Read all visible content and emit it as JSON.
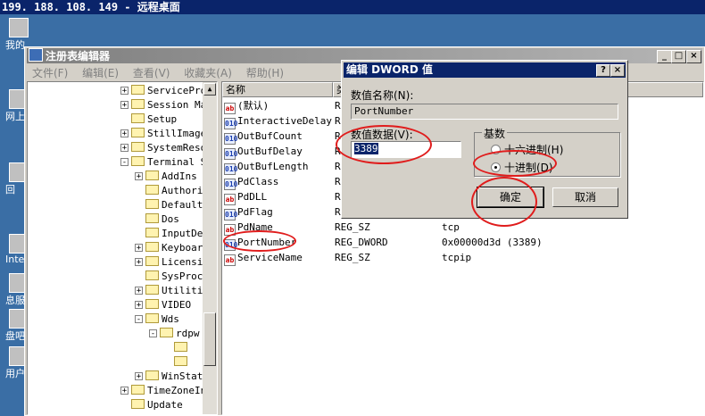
{
  "rdp": {
    "title": "199. 188. 108. 149 - 远程桌面"
  },
  "desktop": {
    "icons": [
      {
        "name": "my-computer-icon",
        "label": "我的"
      },
      {
        "name": "network-icon",
        "label": "网上"
      },
      {
        "name": "recycle-icon",
        "label": "回"
      },
      {
        "name": "internet-icon",
        "label": "Inter"
      },
      {
        "name": "service-icon",
        "label": "息服务"
      },
      {
        "name": "disk-icon",
        "label": "盘吧"
      },
      {
        "name": "tool-icon",
        "label": "用户"
      }
    ]
  },
  "regedit": {
    "title": "注册表编辑器",
    "menu": [
      "文件(F)",
      "编辑(E)",
      "查看(V)",
      "收藏夹(A)",
      "帮助(H)"
    ],
    "tree": [
      {
        "label": "ServicePro",
        "depth": 0,
        "expander": "+"
      },
      {
        "label": "Session Ma",
        "depth": 0,
        "expander": "+"
      },
      {
        "label": "Setup",
        "depth": 0,
        "expander": ""
      },
      {
        "label": "StillImage",
        "depth": 0,
        "expander": "+"
      },
      {
        "label": "SystemReso",
        "depth": 0,
        "expander": "+"
      },
      {
        "label": "Terminal S",
        "depth": 0,
        "expander": "-"
      },
      {
        "label": "AddIns",
        "depth": 1,
        "expander": "+"
      },
      {
        "label": "Authori",
        "depth": 1,
        "expander": ""
      },
      {
        "label": "Default",
        "depth": 1,
        "expander": ""
      },
      {
        "label": "Dos",
        "depth": 1,
        "expander": ""
      },
      {
        "label": "InputDe",
        "depth": 1,
        "expander": ""
      },
      {
        "label": "Keyboar",
        "depth": 1,
        "expander": "+"
      },
      {
        "label": "Licensi",
        "depth": 1,
        "expander": "+"
      },
      {
        "label": "SysProc",
        "depth": 1,
        "expander": ""
      },
      {
        "label": "Utiliti",
        "depth": 1,
        "expander": "+"
      },
      {
        "label": "VIDEO",
        "depth": 1,
        "expander": "+"
      },
      {
        "label": "Wds",
        "depth": 1,
        "expander": "-"
      },
      {
        "label": "rdpw",
        "depth": 2,
        "expander": "-"
      },
      {
        "label": "",
        "depth": 3,
        "expander": ""
      },
      {
        "label": "",
        "depth": 3,
        "expander": ""
      },
      {
        "label": "WinStat",
        "depth": 1,
        "expander": "+"
      },
      {
        "label": "TimeZoneIn",
        "depth": 0,
        "expander": "+"
      },
      {
        "label": "Update",
        "depth": 0,
        "expander": ""
      }
    ],
    "columns": {
      "name": "名称",
      "type": "类",
      "data": ""
    },
    "values": [
      {
        "icon": "ab",
        "kind": "sz",
        "name": "(默认)",
        "type": "R",
        "data": ""
      },
      {
        "icon": "010",
        "kind": "bin",
        "name": "InteractiveDelay",
        "type": "R",
        "data": ""
      },
      {
        "icon": "010",
        "kind": "bin",
        "name": "OutBufCount",
        "type": "R",
        "data": ""
      },
      {
        "icon": "010",
        "kind": "bin",
        "name": "OutBufDelay",
        "type": "R",
        "data": ""
      },
      {
        "icon": "010",
        "kind": "bin",
        "name": "OutBufLength",
        "type": "R",
        "data": ""
      },
      {
        "icon": "010",
        "kind": "bin",
        "name": "PdClass",
        "type": "R",
        "data": ""
      },
      {
        "icon": "ab",
        "kind": "sz",
        "name": "PdDLL",
        "type": "R",
        "data": ""
      },
      {
        "icon": "010",
        "kind": "bin",
        "name": "PdFlag",
        "type": "R",
        "data": ""
      },
      {
        "icon": "ab",
        "kind": "sz",
        "name": "PdName",
        "type": "REG_SZ",
        "data": "tcp"
      },
      {
        "icon": "010",
        "kind": "bin",
        "name": "PortNumber",
        "type": "REG_DWORD",
        "data": "0x00000d3d (3389)"
      },
      {
        "icon": "ab",
        "kind": "sz",
        "name": "ServiceName",
        "type": "REG_SZ",
        "data": "tcpip"
      }
    ]
  },
  "dialog": {
    "title": "编辑 DWORD 值",
    "value_name_label": "数值名称(N):",
    "value_name": "PortNumber",
    "value_data_label": "数值数据(V):",
    "value_data": "3389",
    "base_label": "基数",
    "hex_label": "十六进制(H)",
    "dec_label": "十进制(D)",
    "ok_label": "确定",
    "cancel_label": "取消",
    "help_glyph": "?",
    "close_glyph": "×",
    "selected_base": "decimal"
  },
  "annotation_color": "#e01c1c"
}
